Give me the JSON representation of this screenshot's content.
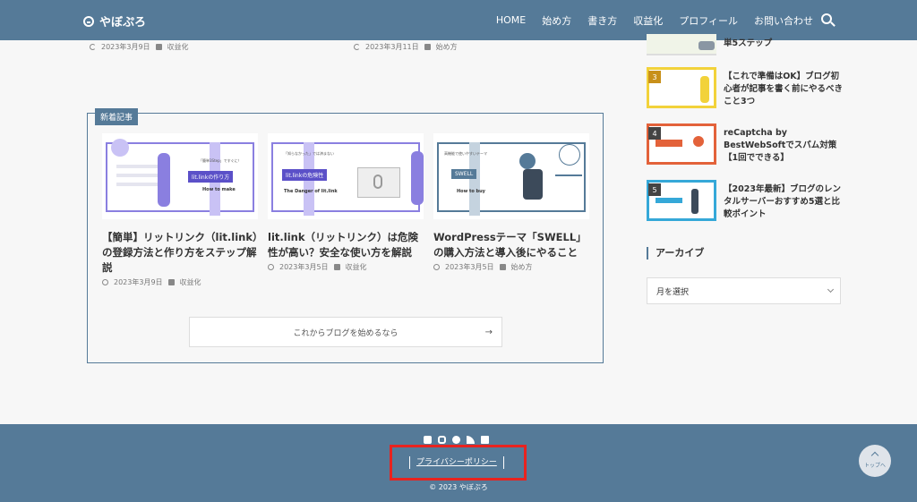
{
  "header": {
    "logo": "やぼぷろ",
    "nav": [
      "HOME",
      "始め方",
      "書き方",
      "収益化",
      "プロフィール",
      "お問い合わせ"
    ]
  },
  "top_meta": [
    {
      "date": "2023年3月9日",
      "category": "収益化"
    },
    {
      "date": "2023年3月11日",
      "category": "始め方"
    }
  ],
  "new_posts": {
    "label": "新着記事",
    "cards": [
      {
        "thumb_tag": "lit.linkの作り方",
        "thumb_sub": "How to make",
        "thumb_small": "「簡単3Step」ですぐに！",
        "title": "【簡単】リットリンク（lit.link）の登録方法と作り方をステップ解説",
        "date": "2023年3月9日",
        "category": "収益化"
      },
      {
        "thumb_tag": "lit.linkの危険性",
        "thumb_sub": "The Danger of lit.link",
        "thumb_small": "「知らなかった」では済まない",
        "title": "lit.link（リットリンク）は危険性が高い？安全な使い方を解説",
        "date": "2023年3月5日",
        "category": "収益化"
      },
      {
        "thumb_tag": "SWELL",
        "thumb_sub": "How to buy",
        "thumb_small": "高機能で使いやすいテーマ",
        "title": "WordPressテーマ「SWELL」の購入方法と導入後にやること",
        "date": "2023年3月5日",
        "category": "始め方"
      }
    ],
    "cta": "これからブログを始めるなら",
    "cta_arrow": "→"
  },
  "ranking": [
    {
      "num": "",
      "title": "単5ステップ"
    },
    {
      "num": "3",
      "title": "【これで準備はOK】ブログ初心者が記事を書く前にやるべきこと3つ"
    },
    {
      "num": "4",
      "title": "reCaptcha by BestWebSoftでスパム対策【1回でできる】"
    },
    {
      "num": "5",
      "title": "【2023年最新】ブログのレンタルサーバーおすすめ5選と比較ポイント"
    }
  ],
  "archive": {
    "heading": "アーカイブ",
    "select": "月を選択"
  },
  "footer": {
    "privacy": "プライバシーポリシー",
    "copyright": "© 2023 やぼぷろ",
    "totop": "トップへ"
  },
  "colors": {
    "brand": "#557a98",
    "highlight": "#e8231f",
    "accent_purple": "#8a7fe0"
  }
}
